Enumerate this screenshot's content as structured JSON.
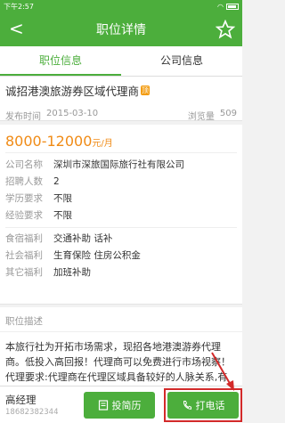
{
  "status_bar": {
    "time": "下午2:57"
  },
  "nav": {
    "title": "职位详情"
  },
  "tabs": [
    {
      "label": "职位信息"
    },
    {
      "label": "公司信息"
    }
  ],
  "job": {
    "title": "诚招港澳旅游券区域代理商",
    "tag": "顶",
    "publish_label": "发布时间",
    "publish_date": "2015-03-10",
    "views_label": "浏览量",
    "views": "509",
    "salary": "8000-12000",
    "salary_unit": "元/月"
  },
  "info": [
    {
      "label": "公司名称",
      "value": "深圳市深旅国际旅行社有限公司"
    },
    {
      "label": "招聘人数",
      "value": "2"
    },
    {
      "label": "学历要求",
      "value": "不限"
    },
    {
      "label": "经验要求",
      "value": "不限"
    }
  ],
  "benefits": [
    {
      "label": "食宿福利",
      "value": "交通补助 话补"
    },
    {
      "label": "社会福利",
      "value": "生育保险 住房公积金"
    },
    {
      "label": "其它福利",
      "value": "加班补助"
    }
  ],
  "description": {
    "heading": "职位描述",
    "text": "本旅行社为开拓市场需求，现招各地港澳游券代理商。低投入高回报！代理商可以免费进行市场视察！代理要求:代理商在代理区域具备较好的人脉关系,有相"
  },
  "footer": {
    "contact_name": "高经理",
    "contact_phone": "18682382344",
    "resume_label": "投简历",
    "call_label": "打电话"
  },
  "colors": {
    "brand": "#4cae3c",
    "salary": "#f08b16",
    "highlight": "#d32a2a"
  }
}
